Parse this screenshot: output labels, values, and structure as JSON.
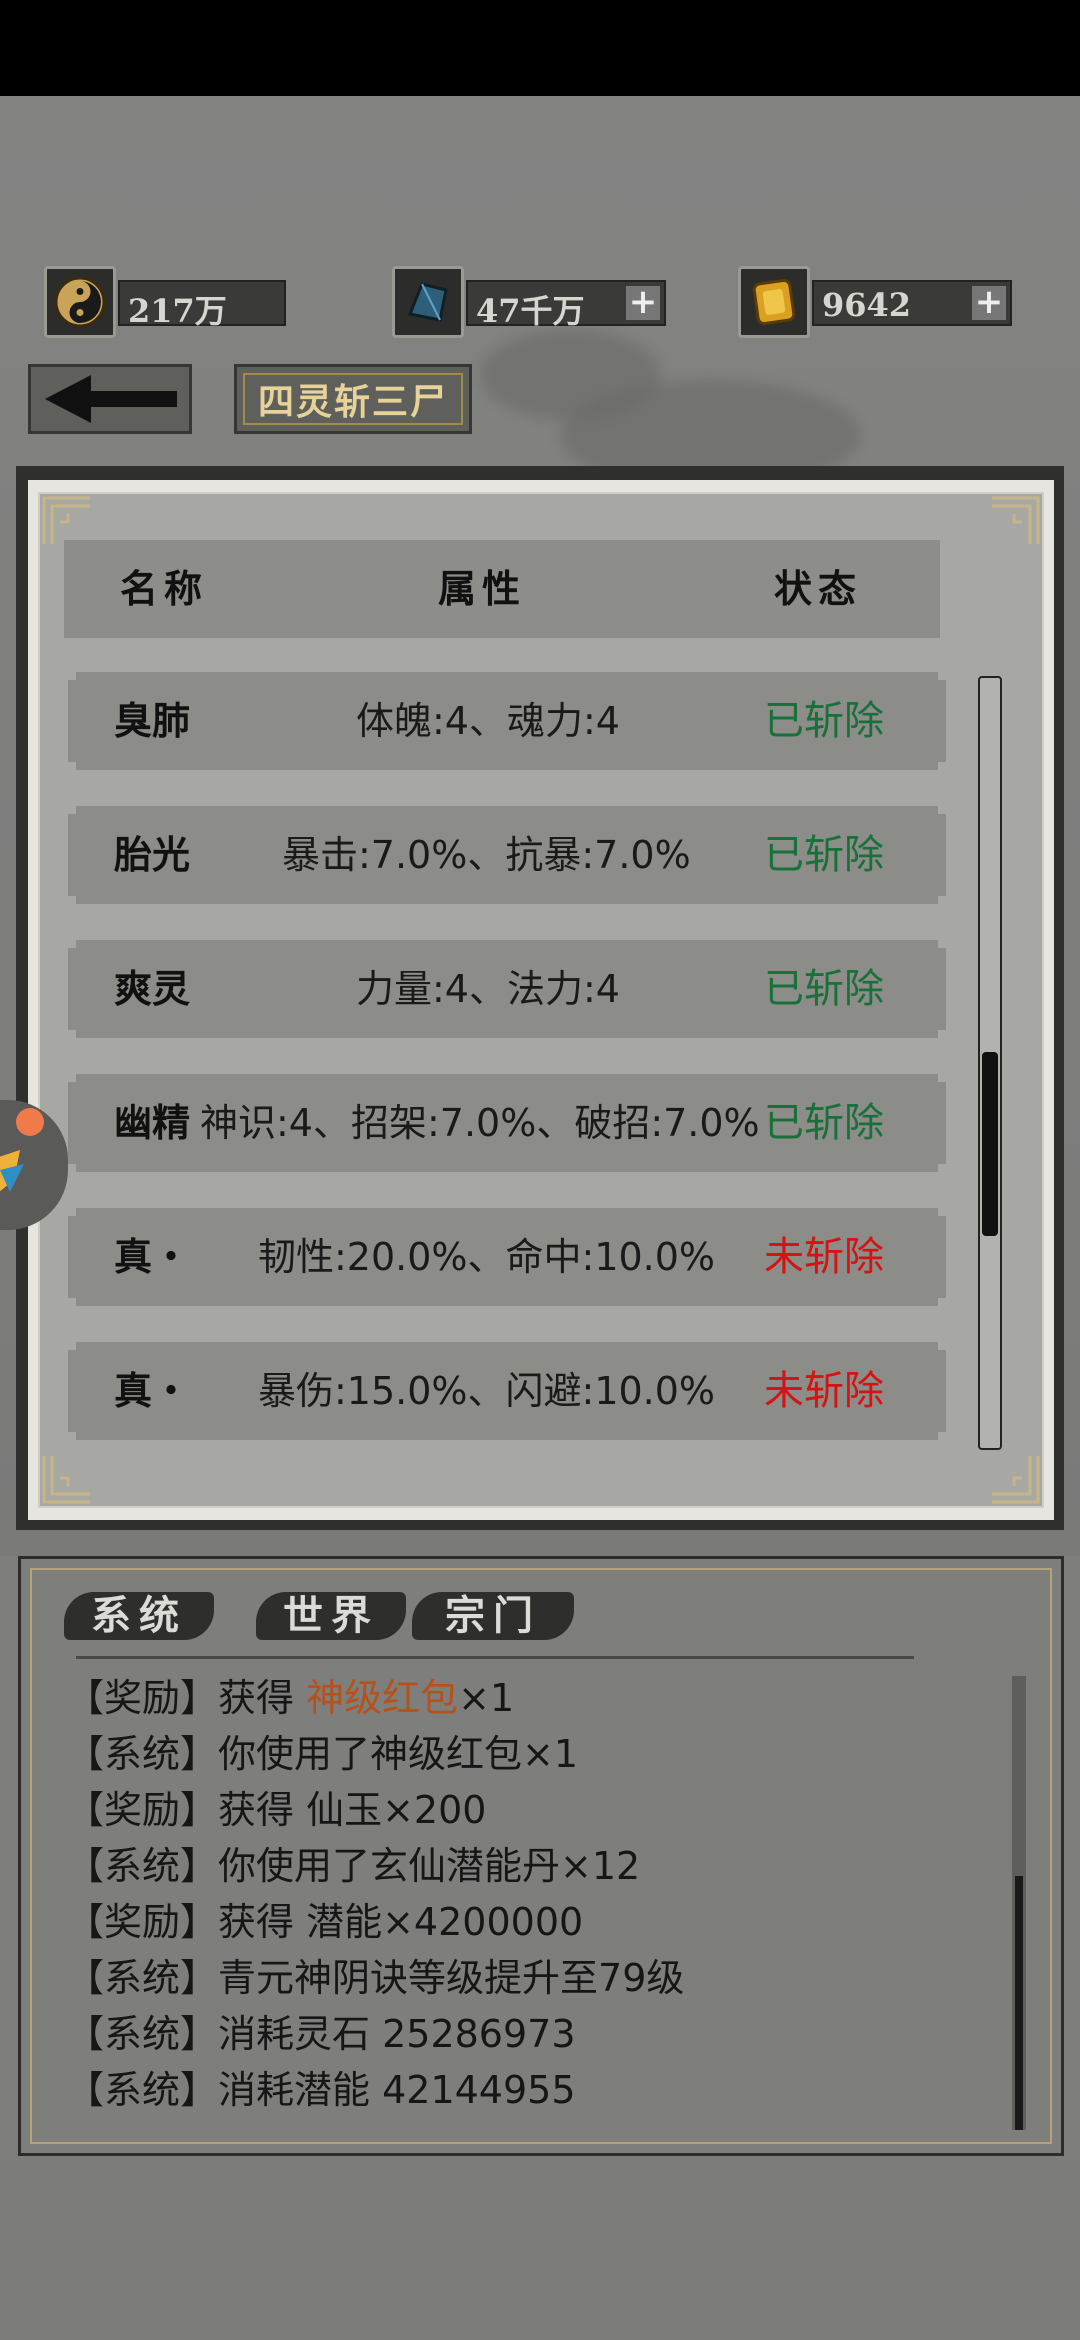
{
  "currencies": [
    {
      "name": "taiji",
      "icon": "yin-yang-icon",
      "value": "217万",
      "has_plus": false
    },
    {
      "name": "xianyu",
      "icon": "blue-crystal-icon",
      "value": "47千万",
      "has_plus": true
    },
    {
      "name": "gold",
      "icon": "gold-ingot-icon",
      "value": "9642",
      "has_plus": true
    }
  ],
  "plus_label": "+",
  "title_tab": "四灵斩三尸",
  "table": {
    "headers": {
      "name": "名称",
      "attr": "属性",
      "status": "状态"
    },
    "rows": [
      {
        "name": "臭肺",
        "attr": "体魄:4、魂力:4",
        "status": "已斩除",
        "done": true
      },
      {
        "name": "胎光",
        "attr": "暴击:7.0%、抗暴:7.0%",
        "status": "已斩除",
        "done": true
      },
      {
        "name": "爽灵",
        "attr": "力量:4、法力:4",
        "status": "已斩除",
        "done": true
      },
      {
        "name": "幽精",
        "attr": "神识:4、招架:7.0%、破招:7.0%",
        "status": "已斩除",
        "done": true
      },
      {
        "name": "真・",
        "attr": "韧性:20.0%、命中:10.0%",
        "status": "未斩除",
        "done": false
      },
      {
        "name": "真・",
        "attr": "暴伤:15.0%、闪避:10.0%",
        "status": "未斩除",
        "done": false
      }
    ]
  },
  "chat": {
    "tabs": [
      "系统",
      "世界",
      "宗门"
    ],
    "messages": [
      {
        "tag": "【奖励】",
        "text": "获得 ",
        "highlight": "神级红包",
        "suffix": "×1"
      },
      {
        "tag": "【系统】",
        "text": "你使用了神级红包×1",
        "highlight": "",
        "suffix": ""
      },
      {
        "tag": "【奖励】",
        "text": "获得 仙玉×200",
        "highlight": "",
        "suffix": ""
      },
      {
        "tag": "【系统】",
        "text": "你使用了玄仙潜能丹×12",
        "highlight": "",
        "suffix": ""
      },
      {
        "tag": "【奖励】",
        "text": "获得 潜能×4200000",
        "highlight": "",
        "suffix": ""
      },
      {
        "tag": "【系统】",
        "text": "青元神阴诀等级提升至79级",
        "highlight": "",
        "suffix": ""
      },
      {
        "tag": "【系统】",
        "text": "消耗灵石 25286973",
        "highlight": "",
        "suffix": ""
      },
      {
        "tag": "【系统】",
        "text": "消耗潜能 42144955",
        "highlight": "",
        "suffix": ""
      }
    ]
  },
  "colors": {
    "done": "#19703a",
    "todo": "#d41313",
    "highlight": "#b5521c"
  }
}
